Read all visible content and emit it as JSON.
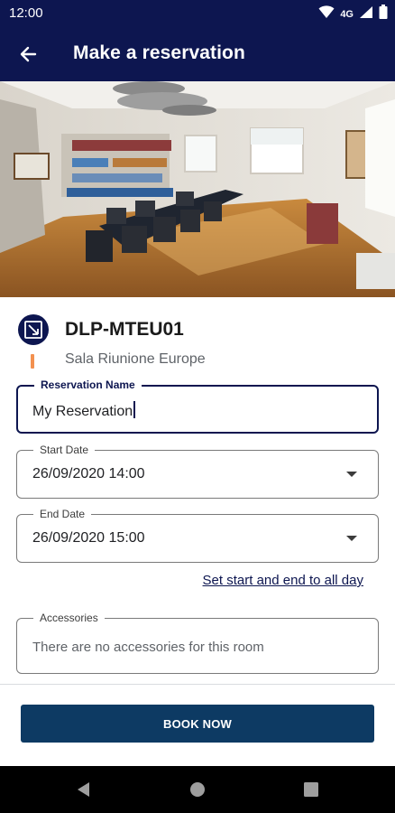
{
  "status_bar": {
    "time": "12:00",
    "network": "4G",
    "icons": [
      "wifi-icon",
      "signal-icon",
      "battery-icon"
    ]
  },
  "app_bar": {
    "title": "Make a reservation",
    "back_icon": "arrow-left-icon"
  },
  "room": {
    "photo": "meeting-room-photo",
    "icon": "room-icon",
    "code": "DLP-MTEU01",
    "name": "Sala Riunione Europe"
  },
  "form": {
    "reservation_name": {
      "label": "Reservation Name",
      "value": "My Reservation"
    },
    "start_date": {
      "label": "Start Date",
      "value": "26/09/2020 14:00"
    },
    "end_date": {
      "label": "End Date",
      "value": "26/09/2020 15:00"
    },
    "all_day_link": "Set start and end to all day",
    "accessories": {
      "label": "Accessories",
      "value": "There are no accessories for this room"
    }
  },
  "actions": {
    "book_now": "BOOK NOW"
  },
  "colors": {
    "primary": "#0d1650",
    "button": "#0d3a63",
    "accent": "#f39150"
  },
  "nav_bar": {
    "icons": [
      "back-triangle-icon",
      "home-circle-icon",
      "recents-square-icon"
    ]
  }
}
